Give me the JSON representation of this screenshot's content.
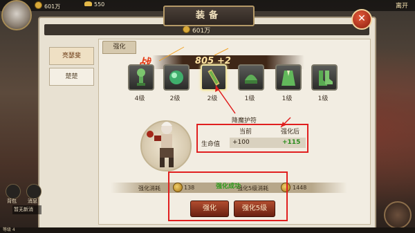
{
  "topbar": {
    "silver": "601万",
    "gold": "550",
    "exit_label": "离开"
  },
  "window": {
    "title": "装备",
    "gold_total": "601万"
  },
  "characters": [
    {
      "name": "亮瑟斐",
      "active": true
    },
    {
      "name": "楚楚",
      "active": false
    }
  ],
  "sub_tab": "强化",
  "power": {
    "glyph": "战",
    "value": "805",
    "increase": "+2"
  },
  "slots": [
    {
      "level": "4级",
      "icon": "mace-icon"
    },
    {
      "level": "2级",
      "icon": "orb-icon"
    },
    {
      "level": "2级",
      "icon": "talisman-icon",
      "selected": true
    },
    {
      "level": "1级",
      "icon": "helmet-icon"
    },
    {
      "level": "1级",
      "icon": "robe-icon"
    },
    {
      "level": "1级",
      "icon": "boots-icon"
    }
  ],
  "item": {
    "name": "降魔护符",
    "col_current": "当前",
    "col_after": "强化后",
    "stat_name": "生命值",
    "stat_current": "+100",
    "stat_after": "+115"
  },
  "cost": {
    "label": "强化消耗",
    "value": "138",
    "success": "强化成功",
    "label5": "强化5级消耗",
    "value5": "1448"
  },
  "buttons": {
    "enhance": "强化",
    "enhance5": "强化5级"
  },
  "hud": {
    "btn1": "背包",
    "btn2": "消息",
    "chat": "暂无新消",
    "level": "等级 4"
  },
  "colors": {
    "annotation": "#e01e1e",
    "stat_up": "#2a8c1c",
    "button": "#8a2e18"
  }
}
